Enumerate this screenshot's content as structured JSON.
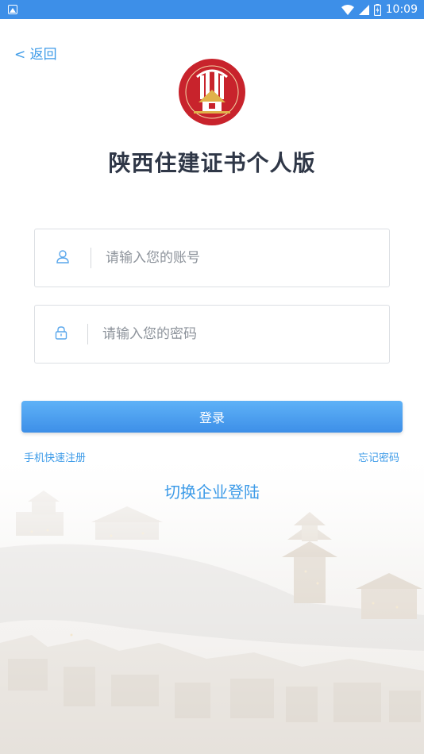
{
  "status_bar": {
    "time": "10:09"
  },
  "nav": {
    "back_label": "< 返回"
  },
  "header": {
    "title": "陕西住建证书个人版"
  },
  "form": {
    "account_placeholder": "请输入您的账号",
    "password_placeholder": "请输入您的密码",
    "login_label": "登录"
  },
  "links": {
    "register": "手机快速注册",
    "forgot_password": "忘记密码",
    "switch_enterprise": "切换企业登陆"
  },
  "colors": {
    "accent": "#3d9be8",
    "status_bar": "#3d8fe8",
    "logo_red": "#c8232c",
    "logo_gold": "#e0b24a"
  },
  "icons": {
    "user": "user-icon",
    "lock": "lock-icon",
    "wifi": "wifi-icon",
    "signal": "signal-icon",
    "battery": "battery-icon"
  }
}
